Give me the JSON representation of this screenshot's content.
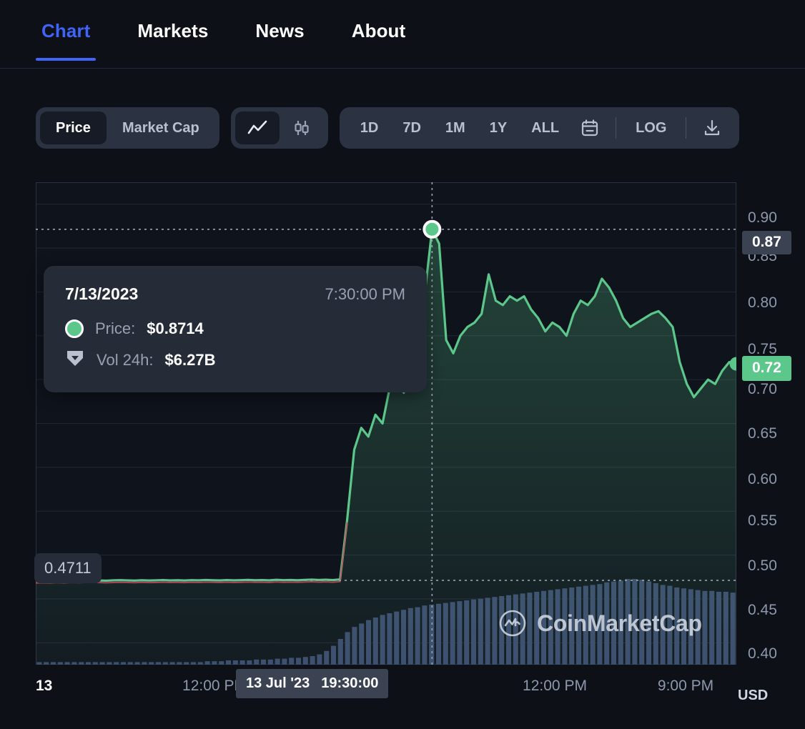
{
  "tabs": [
    {
      "label": "Chart",
      "active": true
    },
    {
      "label": "Markets",
      "active": false
    },
    {
      "label": "News",
      "active": false
    },
    {
      "label": "About",
      "active": false
    }
  ],
  "toolbar": {
    "metric_price": "Price",
    "metric_marketcap": "Market Cap",
    "chart_type_line_icon": "line-chart-icon",
    "chart_type_candle_icon": "candlestick-icon",
    "ranges": [
      "1D",
      "7D",
      "1M",
      "1Y",
      "ALL"
    ],
    "calendar_icon": "calendar-icon",
    "log_label": "LOG",
    "download_icon": "download-icon"
  },
  "tooltip": {
    "date": "7/13/2023",
    "time": "7:30:00 PM",
    "price_label": "Price:",
    "price_value": "$0.8714",
    "volume_label": "Vol 24h:",
    "volume_value": "$6.27B",
    "price_marker_icon": "price-dot-icon",
    "volume_marker_icon": "volume-shield-icon"
  },
  "axis": {
    "y_ticks": [
      "0.90",
      "0.85",
      "0.80",
      "0.75",
      "0.70",
      "0.65",
      "0.60",
      "0.55",
      "0.50",
      "0.45",
      "0.40"
    ],
    "y_crosshair_value": "0.87",
    "y_current_value": "0.72",
    "y_left_badge": "0.4711",
    "currency": "USD",
    "x_ticks": [
      "13",
      "12:00 PM",
      "12:00 PM",
      "9:00 PM"
    ],
    "x_crosshair_date": "13 Jul '23",
    "x_crosshair_time": "19:30:00"
  },
  "watermark": {
    "text": "CoinMarketCap",
    "logo_icon": "coinmarketcap-logo-icon"
  },
  "colors": {
    "accent_blue": "#3f64f7",
    "line_green": "#5bc78a",
    "volume_bar": "#3c4a6e",
    "background": "#0d1017",
    "panel": "#2b3242"
  },
  "chart_data": {
    "type": "area",
    "title": "",
    "xlabel": "",
    "ylabel": "USD",
    "ylim": [
      0.375,
      0.925
    ],
    "grid": true,
    "series": [
      {
        "name": "Price",
        "color": "#5bc78a",
        "unit": "USD",
        "x": [
          0,
          1,
          2,
          3,
          4,
          5,
          6,
          7,
          8,
          9,
          10,
          11,
          12,
          13,
          14,
          15,
          16,
          17,
          18,
          19,
          20,
          21,
          22,
          23,
          24,
          25,
          26,
          27,
          28,
          29,
          30,
          31,
          32,
          33,
          34,
          35,
          36,
          37,
          38,
          39,
          40,
          41,
          42,
          43,
          44,
          45,
          46,
          47,
          48,
          49,
          50,
          51,
          52,
          53,
          54,
          55,
          56,
          57,
          58,
          59,
          60,
          61,
          62,
          63,
          64,
          65,
          66,
          67,
          68,
          69,
          70,
          71,
          72,
          73,
          74,
          75,
          76,
          77,
          78,
          79,
          80,
          81,
          82,
          83,
          84,
          85,
          86,
          87,
          88,
          89,
          90,
          91,
          92,
          93,
          94,
          95,
          96,
          97,
          98,
          99
        ],
        "values": [
          0.4705,
          0.4708,
          0.4706,
          0.471,
          0.4707,
          0.4712,
          0.4709,
          0.4711,
          0.4713,
          0.471,
          0.4708,
          0.4712,
          0.4714,
          0.4711,
          0.4709,
          0.4713,
          0.471,
          0.4712,
          0.4715,
          0.4711,
          0.4713,
          0.471,
          0.4714,
          0.4712,
          0.4716,
          0.4713,
          0.4711,
          0.4715,
          0.4712,
          0.4714,
          0.4717,
          0.4713,
          0.4715,
          0.4712,
          0.4718,
          0.4714,
          0.4716,
          0.4713,
          0.4717,
          0.472,
          0.4716,
          0.4719,
          0.4715,
          0.4722,
          0.54,
          0.62,
          0.645,
          0.635,
          0.66,
          0.65,
          0.69,
          0.7,
          0.685,
          0.73,
          0.755,
          0.8,
          0.8714,
          0.855,
          0.745,
          0.73,
          0.75,
          0.76,
          0.765,
          0.775,
          0.82,
          0.79,
          0.785,
          0.795,
          0.79,
          0.795,
          0.78,
          0.77,
          0.755,
          0.765,
          0.76,
          0.75,
          0.775,
          0.79,
          0.785,
          0.795,
          0.815,
          0.805,
          0.79,
          0.77,
          0.76,
          0.765,
          0.77,
          0.775,
          0.778,
          0.77,
          0.76,
          0.72,
          0.695,
          0.68,
          0.69,
          0.7,
          0.695,
          0.71,
          0.72,
          0.718
        ]
      },
      {
        "name": "Volume 24h",
        "color": "#3c4a6e",
        "unit": "USD",
        "values": [
          0.03,
          0.03,
          0.03,
          0.03,
          0.03,
          0.03,
          0.03,
          0.03,
          0.03,
          0.03,
          0.03,
          0.03,
          0.03,
          0.03,
          0.03,
          0.03,
          0.03,
          0.03,
          0.03,
          0.03,
          0.03,
          0.03,
          0.03,
          0.03,
          0.04,
          0.04,
          0.04,
          0.05,
          0.05,
          0.05,
          0.05,
          0.06,
          0.06,
          0.06,
          0.07,
          0.07,
          0.08,
          0.08,
          0.09,
          0.1,
          0.12,
          0.16,
          0.22,
          0.3,
          0.38,
          0.44,
          0.48,
          0.52,
          0.55,
          0.58,
          0.6,
          0.62,
          0.64,
          0.66,
          0.67,
          0.69,
          0.7,
          0.71,
          0.72,
          0.73,
          0.74,
          0.75,
          0.76,
          0.77,
          0.78,
          0.79,
          0.8,
          0.81,
          0.82,
          0.83,
          0.84,
          0.85,
          0.86,
          0.87,
          0.88,
          0.89,
          0.9,
          0.91,
          0.92,
          0.93,
          0.94,
          0.96,
          0.97,
          0.98,
          1.0,
          1.0,
          0.99,
          0.97,
          0.95,
          0.93,
          0.92,
          0.9,
          0.89,
          0.88,
          0.87,
          0.86,
          0.86,
          0.85,
          0.85,
          0.84
        ]
      }
    ],
    "annotations": {
      "crosshair_x_index": 56,
      "crosshair_price": 0.8714,
      "crosshair_label": "7/13/2023 7:30:00 PM",
      "last_price": 0.72,
      "baseline_price": 0.4711
    }
  }
}
